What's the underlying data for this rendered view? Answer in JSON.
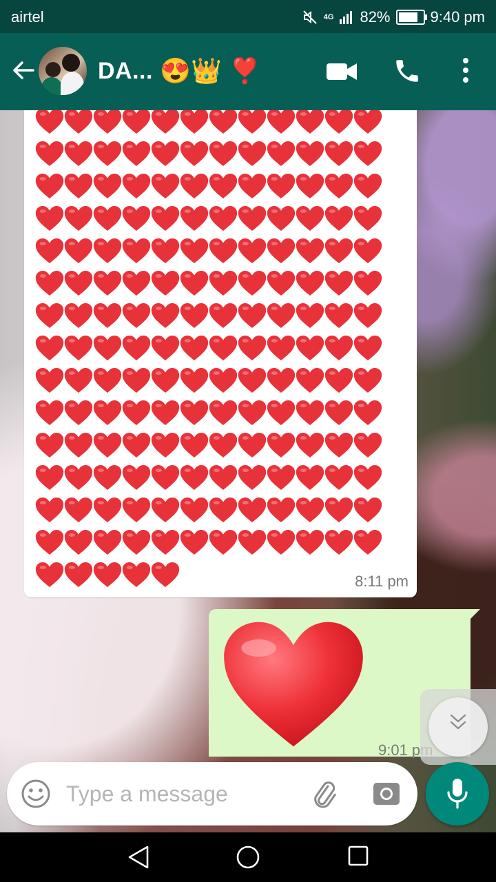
{
  "status_bar": {
    "carrier": "airtel",
    "network": "4G",
    "battery_percent": "82%",
    "battery_level": 0.82,
    "time": "9:40 pm",
    "icons": [
      "mute-icon",
      "signal-icon",
      "battery-icon"
    ]
  },
  "header": {
    "contact_name": "DA...",
    "name_emojis": "😍👑 ❣️",
    "icons": [
      "back-arrow-icon",
      "avatar",
      "video-call-icon",
      "phone-icon",
      "more-options-icon"
    ]
  },
  "messages": [
    {
      "direction": "incoming",
      "content": "red-heart emoji grid",
      "heart_rows_full": 14,
      "hearts_per_row": 12,
      "hearts_last_row": 5,
      "time": "8:11 pm"
    },
    {
      "direction": "outgoing",
      "content": "large red heart emoji",
      "time": "9:01 pm",
      "status": "read"
    }
  ],
  "composer": {
    "placeholder": "Type a message",
    "icons": [
      "emoji-icon",
      "attach-icon",
      "camera-icon",
      "mic-icon"
    ]
  },
  "scroll_button": {
    "icon": "chevron-double-down-icon"
  },
  "nav_bar": {
    "icons": [
      "back-triangle-icon",
      "home-circle-icon",
      "recents-square-icon"
    ]
  },
  "colors": {
    "app_bar": "#075e54",
    "status_bar": "#07463f",
    "outgoing_bubble": "#dcf8c6",
    "incoming_bubble": "#ffffff",
    "heart": "#e8323a",
    "fab": "#00897b",
    "read_ticks": "#4fc3f7"
  }
}
